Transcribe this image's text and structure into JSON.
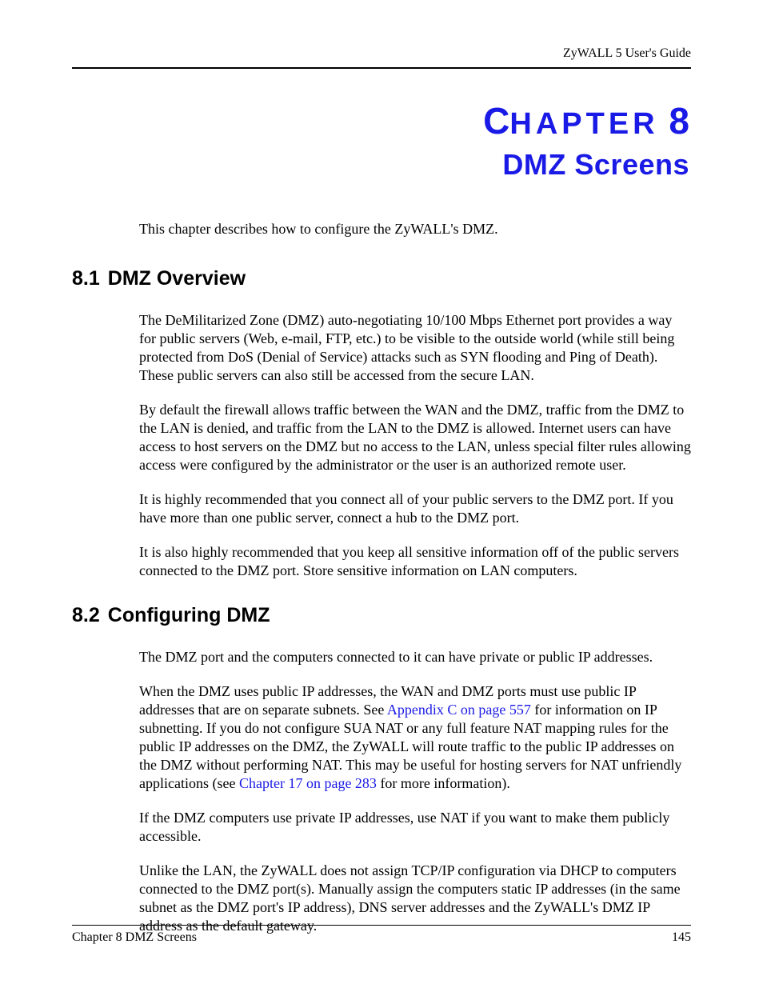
{
  "header": {
    "guide_title": "ZyWALL 5 User's Guide"
  },
  "chapter": {
    "label_prefix": "C",
    "label_mid": "HAPTER",
    "label_num": " 8",
    "title": "DMZ Screens",
    "intro": "This chapter describes how to configure the ZyWALL's DMZ."
  },
  "sections": [
    {
      "number": "8.1",
      "title": "DMZ Overview",
      "paragraphs": [
        "The DeMilitarized Zone (DMZ) auto-negotiating 10/100 Mbps Ethernet port provides a way for public servers (Web, e-mail, FTP, etc.) to be visible to the outside world (while still being protected from DoS (Denial of Service) attacks such as SYN flooding and Ping of Death). These public servers can also still be accessed from the secure LAN.",
        "By default the firewall allows traffic between the WAN and the DMZ, traffic from the DMZ to the LAN is denied, and traffic from the LAN to the DMZ is allowed. Internet users can have access to host servers on the DMZ but no access to the LAN, unless special filter rules allowing access were configured by the administrator or the user is an authorized remote user.",
        "It is highly recommended that you connect all of your public servers to the DMZ port. If you have more than one public server, connect a hub to the DMZ port.",
        "It is also highly recommended that you keep all sensitive information off of the public servers connected to the DMZ port. Store sensitive information on LAN computers."
      ]
    },
    {
      "number": "8.2",
      "title": "Configuring DMZ",
      "paragraphs_pre_link1": "The DMZ port and the computers connected to it can have private or public IP addresses.",
      "para2_a": "When the DMZ uses public IP addresses, the WAN and DMZ ports must use public IP addresses that are on separate subnets. See ",
      "para2_link1": "Appendix C on page 557",
      "para2_b": " for information on IP subnetting. If you do not configure SUA NAT or any full feature NAT mapping rules for the public IP addresses on the DMZ, the ZyWALL will route traffic to the public IP addresses on the DMZ without performing NAT. This may be useful for hosting servers for NAT unfriendly applications (see ",
      "para2_link2": "Chapter 17 on page 283",
      "para2_c": " for more information).",
      "para3": "If the DMZ computers use private IP addresses, use NAT if you want to make them publicly accessible.",
      "para4": "Unlike the LAN, the ZyWALL does not assign TCP/IP configuration via DHCP to computers connected to the DMZ port(s). Manually assign the computers static IP addresses (in the same subnet as the DMZ port's IP address), DNS server addresses and the ZyWALL's DMZ IP address as the default gateway."
    }
  ],
  "footer": {
    "left": "Chapter 8 DMZ Screens",
    "right": "145"
  }
}
